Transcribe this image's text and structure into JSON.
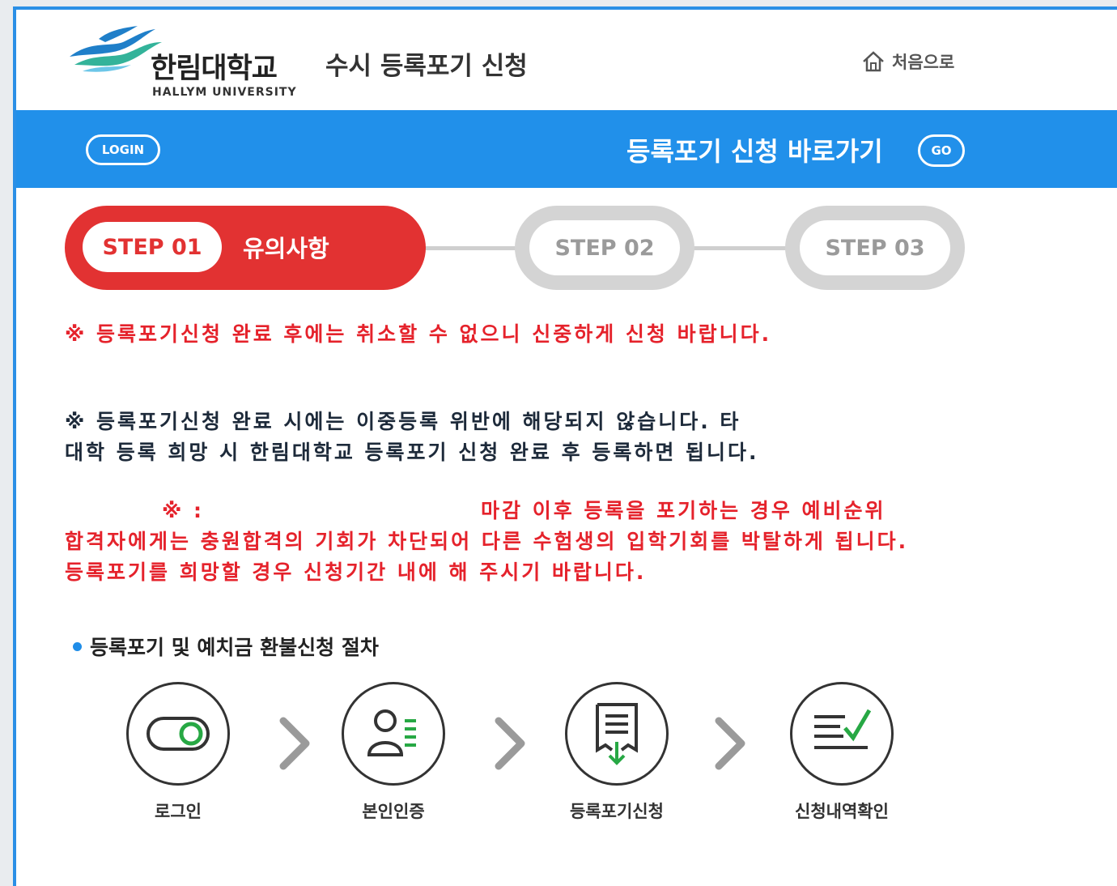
{
  "header": {
    "logo_kr": "한림대학교",
    "logo_en": "HALLYM UNIVERSITY",
    "page_title": "수시 등록포기 신청",
    "home_label": "처음으로"
  },
  "bluebar": {
    "login_label": "LOGIN",
    "go_text": "등록포기 신청 바로가기",
    "go_label": "GO"
  },
  "steps": [
    {
      "label": "STEP 01",
      "title": "유의사항",
      "active": true
    },
    {
      "label": "STEP 02",
      "active": false
    },
    {
      "label": "STEP 03",
      "active": false
    }
  ],
  "notices": {
    "n1": "※ 등록포기신청 완료 후에는 취소할 수 없으니 신중하게 신청 바랍니다.",
    "n2_line1": "※ 등록포기신청 완료 시에는 이중등록 위반에 해당되지 않습니다. 타",
    "n2_line2": "대학 등록 희망 시 한림대학교 등록포기 신청 완료 후 등록하면 됩니다.",
    "n3_mark": "※ :",
    "n3_line1": "마감 이후 등록을 포기하는 경우 예비순위",
    "n3_line2": "합격자에게는 충원합격의 기회가 차단되어 다른 수험생의 입학기회를 박탈하게 됩니다.",
    "n3_line3": "등록포기를 희망할 경우 신청기간 내에 해 주시기 바랍니다."
  },
  "procedure": {
    "title": "등록포기 및 예치금 환불신청 절차",
    "steps": [
      {
        "label": "로그인",
        "icon": "toggle-icon"
      },
      {
        "label": "본인인증",
        "icon": "user-list-icon"
      },
      {
        "label": "등록포기신청",
        "icon": "document-download-icon"
      },
      {
        "label": "신청내역확인",
        "icon": "checklist-icon"
      }
    ]
  },
  "colors": {
    "brand_blue": "#2190ea",
    "accent_red": "#e23232",
    "icon_green": "#27a844"
  }
}
